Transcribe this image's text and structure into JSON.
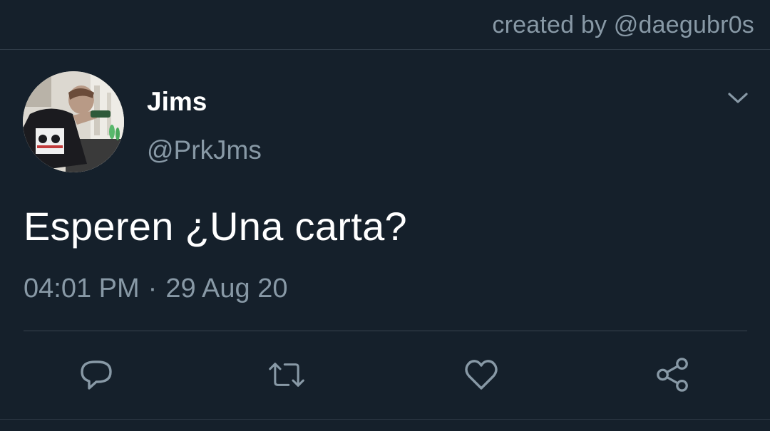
{
  "header": {
    "credit": "created by @daegubr0s"
  },
  "tweet": {
    "author": {
      "name": "Jims",
      "handle": "@PrkJms",
      "avatar_icon": "avatar-photo"
    },
    "text": "Esperen ¿Una carta?",
    "time": "04:01 PM",
    "separator": "·",
    "date": "29 Aug 20"
  },
  "actions": [
    {
      "name": "reply",
      "icon": "reply-icon"
    },
    {
      "name": "retweet",
      "icon": "retweet-icon"
    },
    {
      "name": "like",
      "icon": "heart-icon"
    },
    {
      "name": "share",
      "icon": "share-icon"
    }
  ],
  "colors": {
    "background": "#15202b",
    "primary_text": "#ffffff",
    "secondary_text": "#8899a6",
    "divider": "#38444d"
  }
}
